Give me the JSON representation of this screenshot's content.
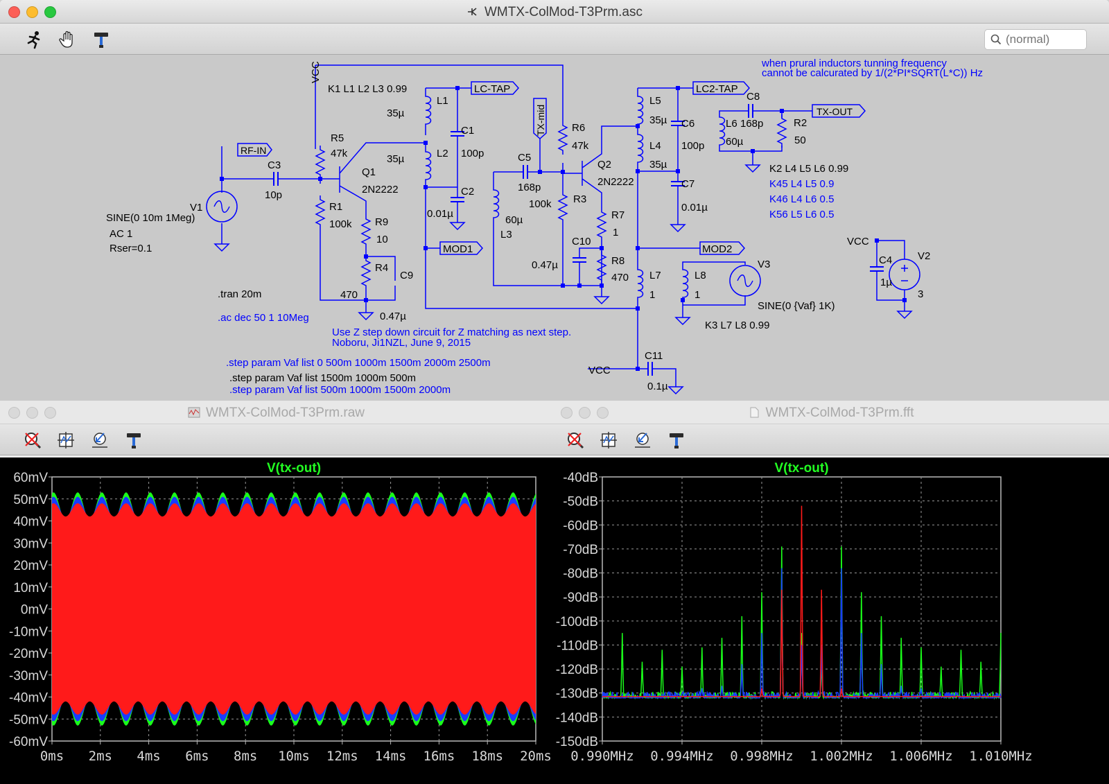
{
  "schematic_window": {
    "title": "WMTX-ColMod-T3Prm.asc",
    "search_placeholder": "(normal)",
    "labels": {
      "vcc_top": "VCC",
      "k1": "K1 L1 L2 L3 0.99",
      "lc_tap": "LC-TAP",
      "lc2_tap": "LC2-TAP",
      "tx_out": "TX-OUT",
      "tx_mid": "TX-mid",
      "rf_in": "RF-IN",
      "mod1": "MOD1",
      "mod2": "MOD2",
      "note1": "when prural inductors tunning frequency",
      "note2": "cannot be calcurated by 1/(2*PI*SQRT(L*C)) Hz",
      "c8": "C8",
      "l6": "L6",
      "l6_val": "60µ",
      "c8_val": "168p",
      "r2": "R2",
      "r2_val": "50",
      "l5": "L5",
      "l5_val": "35µ",
      "c6": "C6",
      "c6_val": "100p",
      "l4": "L4",
      "l4_val": "35µ",
      "k2": "K2 L4 L5 L6 0.99",
      "k45": "K45 L4 L5  0.9",
      "k46": "K46 L4 L6  0.5",
      "k56": "K56 L5 L6  0.5",
      "c7": "C7",
      "c7_val": "0.01µ",
      "l1": "L1",
      "l1_val": "35µ",
      "c1": "C1",
      "c1_val": "100p",
      "l2": "L2",
      "l2_val": "35µ",
      "c2": "C2",
      "c2_val": "0.01µ",
      "r5": "R5",
      "r5_val": "47k",
      "q1": "Q1",
      "q1_model": "2N2222",
      "c3": "C3",
      "c3_val": "10p",
      "v1": "V1",
      "v1_sine": "SINE(0 10m 1Meg)",
      "v1_ac": "AC 1",
      "v1_rser": "Rser=0.1",
      "r1": "R1",
      "r1_val": "100k",
      "r9": "R9",
      "r9_val": "10",
      "r4": "R4",
      "r4_val": "470",
      "c9": "C9",
      "c9_val": "0.47µ",
      "tran": ".tran 20m",
      "ac": ".ac dec 50 1 10Meg",
      "r6": "R6",
      "r6_val": "47k",
      "q2": "Q2",
      "q2_model": "2N2222",
      "c5": "C5",
      "c5_val": "168p",
      "l3": "L3",
      "l3_val": "60µ",
      "r3": "R3",
      "r3_val": "100k",
      "r7": "R7",
      "r7_val": "1",
      "c10": "C10",
      "c10_val": "0.47µ",
      "r8": "R8",
      "r8_val": "470",
      "l7": "L7",
      "l7_val": "1",
      "l8": "L8",
      "l8_val": "1",
      "v3": "V3",
      "v3_sine": "SINE(0 {Vaf} 1K)",
      "k3": "K3 L7 L8 0.99",
      "vcc_v2": "VCC",
      "c4": "C4",
      "c4_val": "1µ",
      "v2": "V2",
      "v2_val": "3",
      "c11": "C11",
      "c11_val": "0.1µ",
      "vcc_c11": "VCC",
      "note3": "Use Z step down circuit for Z matching as next step.",
      "note4": "Noboru, Ji1NZL, June 9, 2015",
      "step1": ".step param Vaf list 0 500m 1000m 1500m 2000m 2500m",
      "step2": ".step param Vaf list  1500m 1000m 500m",
      "step3": ".step param Vaf list 500m 1000m 1500m 2000m"
    }
  },
  "raw_window": {
    "title": "WMTX-ColMod-T3Prm.raw",
    "trace_label": "V(tx-out)"
  },
  "fft_window": {
    "title": "WMTX-ColMod-T3Prm.fft",
    "trace_label": "V(tx-out)"
  },
  "colors": {
    "wire": "#0000ff",
    "red": "#ff1a1a",
    "green": "#1aff1a",
    "blue": "#1a3cff",
    "grid": "#9a9a9a",
    "label_green": "#22ff22"
  },
  "chart_data": [
    {
      "type": "line",
      "title": "V(tx-out)",
      "x_unit": "ms",
      "xlim": [
        0,
        20
      ],
      "ylim": [
        -60,
        60
      ],
      "x_ticks": [
        "0ms",
        "2ms",
        "4ms",
        "6ms",
        "8ms",
        "10ms",
        "12ms",
        "14ms",
        "16ms",
        "18ms",
        "20ms"
      ],
      "y_ticks": [
        "60mV",
        "50mV",
        "40mV",
        "30mV",
        "20mV",
        "10mV",
        "0mV",
        "-10mV",
        "-20mV",
        "-30mV",
        "-40mV",
        "-50mV",
        "-60mV"
      ],
      "series": [
        {
          "color": "#1aff1a",
          "envelope_peak": 53,
          "envelope_trough": 40,
          "envelope_cycles": 20
        },
        {
          "color": "#1a3cff",
          "envelope_peak": 51,
          "envelope_trough": 41,
          "envelope_cycles": 20
        },
        {
          "color": "#ff1a1a",
          "envelope_peak": 48,
          "envelope_trough": 42,
          "envelope_cycles": 20
        }
      ]
    },
    {
      "type": "line",
      "title": "V(tx-out)",
      "x_unit": "MHz",
      "xlim": [
        0.99,
        1.01
      ],
      "ylim": [
        -150,
        -40
      ],
      "x_ticks": [
        "0.990MHz",
        "0.994MHz",
        "0.998MHz",
        "1.002MHz",
        "1.006MHz",
        "1.010MHz"
      ],
      "y_ticks": [
        "-40dB",
        "-50dB",
        "-60dB",
        "-70dB",
        "-80dB",
        "-90dB",
        "-100dB",
        "-110dB",
        "-120dB",
        "-130dB",
        "-140dB",
        "-150dB"
      ],
      "noise_floor": -132,
      "series": [
        {
          "color": "#1aff1a",
          "peaks": [
            [
              0.991,
              -105
            ],
            [
              0.992,
              -117
            ],
            [
              0.993,
              -112
            ],
            [
              0.994,
              -119
            ],
            [
              0.995,
              -111
            ],
            [
              0.996,
              -107
            ],
            [
              0.997,
              -98
            ],
            [
              0.998,
              -88
            ],
            [
              0.999,
              -69
            ],
            [
              1.0,
              -105
            ],
            [
              1.001,
              -117
            ],
            [
              1.002,
              -69
            ],
            [
              1.003,
              -88
            ],
            [
              1.004,
              -98
            ],
            [
              1.005,
              -107
            ],
            [
              1.006,
              -111
            ],
            [
              1.007,
              -119
            ],
            [
              1.008,
              -112
            ],
            [
              1.009,
              -117
            ],
            [
              1.01,
              -105
            ]
          ]
        },
        {
          "color": "#1a3cff",
          "peaks": [
            [
              0.995,
              -128
            ],
            [
              0.996,
              -127
            ],
            [
              0.997,
              -118
            ],
            [
              0.998,
              -105
            ],
            [
              0.999,
              -78
            ],
            [
              1.0,
              -110
            ],
            [
              1.001,
              -110
            ],
            [
              1.002,
              -78
            ],
            [
              1.003,
              -105
            ],
            [
              1.004,
              -118
            ],
            [
              1.005,
              -127
            ],
            [
              1.006,
              -128
            ]
          ]
        },
        {
          "color": "#ff1a1a",
          "peaks": [
            [
              0.998,
              -128
            ],
            [
              0.999,
              -87
            ],
            [
              1.0,
              -52
            ],
            [
              1.001,
              -87
            ],
            [
              1.002,
              -128
            ]
          ]
        }
      ]
    }
  ]
}
